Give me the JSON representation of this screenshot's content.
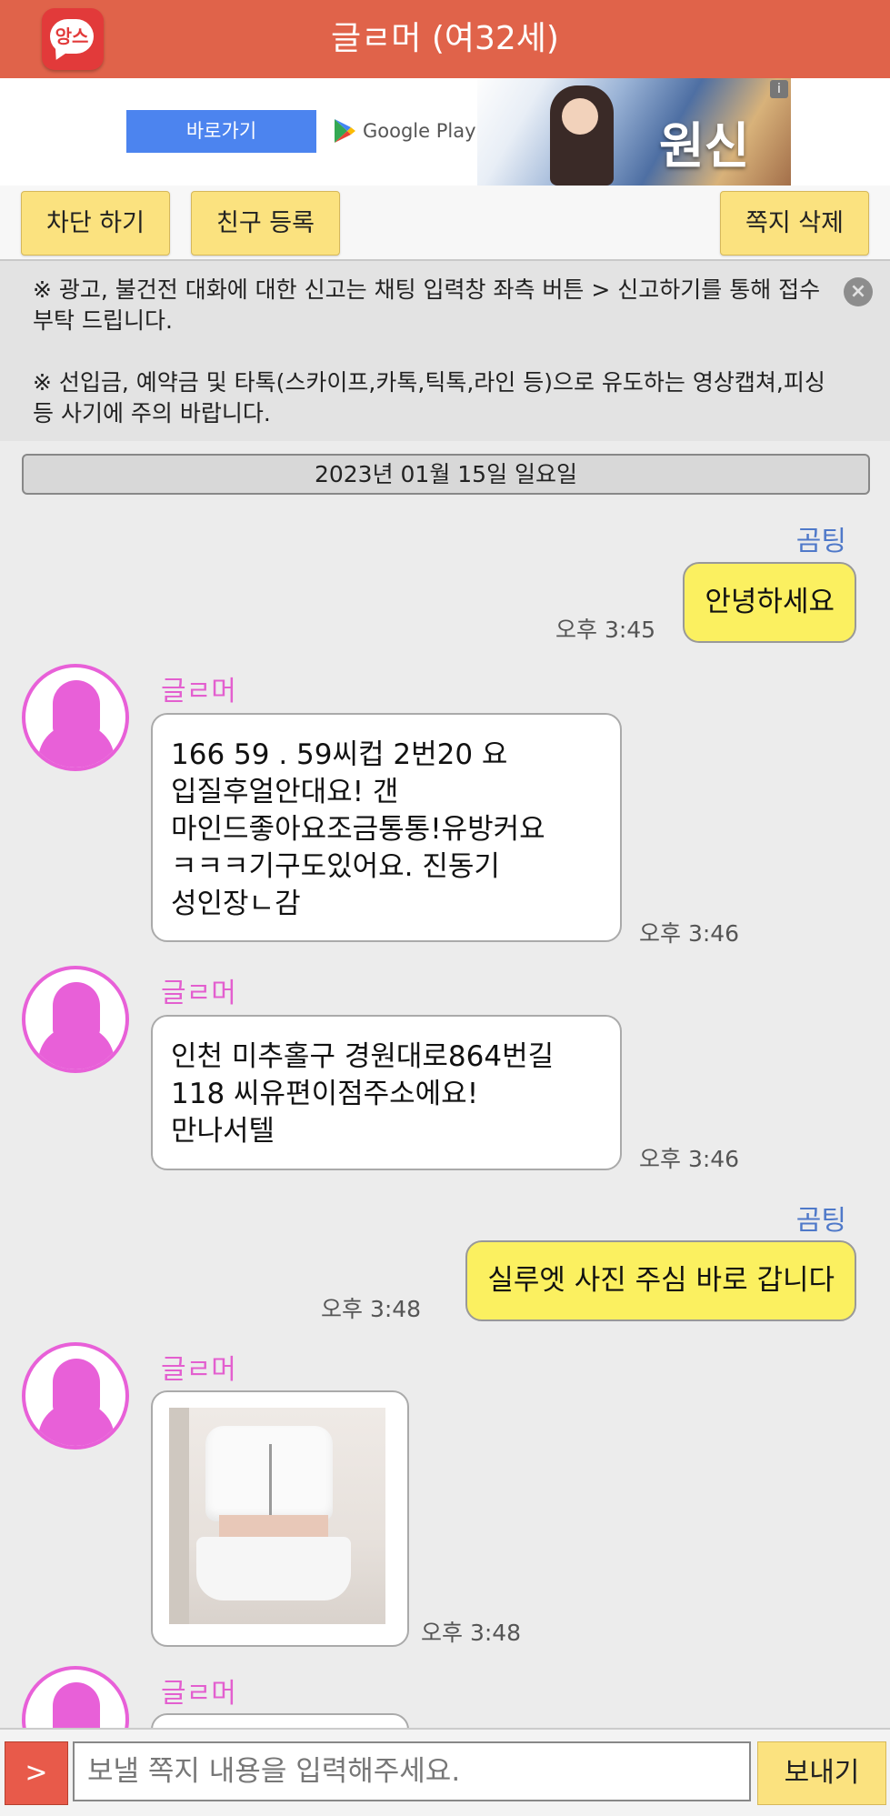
{
  "header": {
    "logo_text": "앙스",
    "title": "글ㄹ머 (여32세)",
    "color": "#e0634a"
  },
  "ad": {
    "button_label": "바로가기",
    "store_label": "Google Play",
    "game_title": "원신",
    "info_icon": "ad-info-icon"
  },
  "actions": {
    "block_label": "차단 하기",
    "friend_label": "친구 등록",
    "delete_label": "쪽지 삭제"
  },
  "notice": {
    "line1": "※ 광고, 불건전 대화에 대한 신고는 채팅 입력창 좌측 버튼 > 신고하기를 통해 접수 부탁 드립니다.",
    "line2": "※ 선입금, 예약금 및 타톡(스카이프,카톡,틱톡,라인 등)으로 유도하는 영상캡쳐,피싱 등 사기에 주의 바랍니다."
  },
  "date_label": "2023년 01월 15일 일요일",
  "messages": [
    {
      "sender": "곰팅",
      "text": "안녕하세요",
      "time": "오후 3:45"
    },
    {
      "sender": "글ㄹ머",
      "text": "166  59 . 59씨컵  2번20 요\n입질후얼안대요! 갠\n마인드좋아요조금통통!유방커요\nㅋㅋㅋ기구도있어요. 진동기\n성인장ㄴ감",
      "time": "오후 3:46"
    },
    {
      "sender": "글ㄹ머",
      "text": "인천 미추홀구 경원대로864번길\n118 씨유편이점주소에요!\n만나서텔",
      "time": "오후 3:46"
    },
    {
      "sender": "곰팅",
      "text": "실루엣 사진 주심 바로 갑니다",
      "time": "오후 3:48"
    },
    {
      "sender": "글ㄹ머",
      "text": "",
      "time": "오후 3:48"
    },
    {
      "sender": "글ㄹ머",
      "text": "",
      "time": ""
    }
  ],
  "input": {
    "report_label": ">",
    "placeholder": "보낼 쪽지 내용을 입력해주세요.",
    "send_label": "보내기"
  },
  "colors": {
    "me_bubble": "#fbf060",
    "me_name": "#4f79c9",
    "her_name": "#e35fcf",
    "action_button": "#fbe27f"
  }
}
